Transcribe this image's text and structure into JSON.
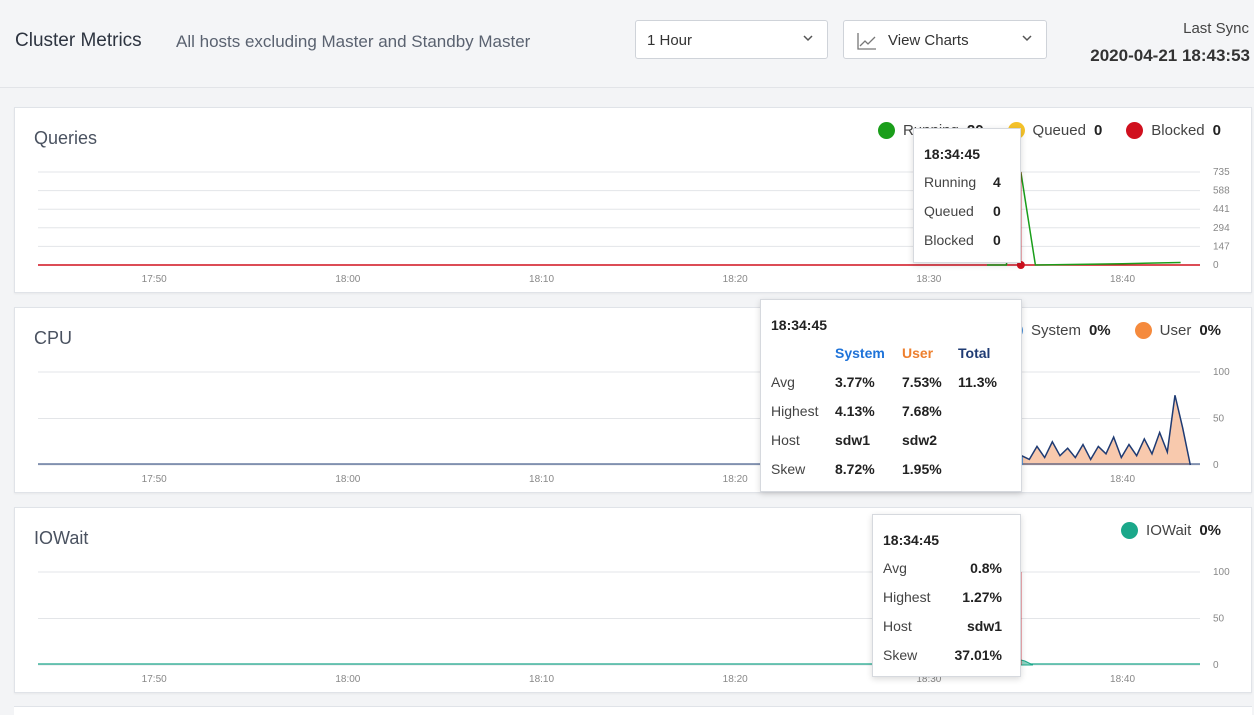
{
  "header": {
    "title": "Cluster Metrics",
    "subtitle": "All hosts excluding Master and Standby Master",
    "time_range": "1 Hour",
    "view_mode": "View Charts",
    "last_sync_label": "Last Sync",
    "last_sync_value": "2020-04-21 18:43:53",
    "icons": {
      "chevron": "chevron-down-icon",
      "view": "line-chart-icon"
    }
  },
  "x_ticks": [
    "17:50",
    "18:00",
    "18:10",
    "18:20",
    "18:30",
    "18:40"
  ],
  "queries": {
    "title": "Queries",
    "legend": [
      {
        "name": "Running",
        "value": "20",
        "color": "#1a9e1a"
      },
      {
        "name": "Queued",
        "value": "0",
        "color": "#f4c22b"
      },
      {
        "name": "Blocked",
        "value": "0",
        "color": "#d0101e"
      }
    ],
    "y_ticks": [
      "735",
      "588",
      "441",
      "294",
      "147",
      "0"
    ],
    "tooltip": {
      "time": "18:34:45",
      "rows": [
        {
          "label": "Running",
          "value": "4"
        },
        {
          "label": "Queued",
          "value": "0"
        },
        {
          "label": "Blocked",
          "value": "0"
        }
      ]
    }
  },
  "cpu": {
    "title": "CPU",
    "legend": [
      {
        "name": "System",
        "value": "0%",
        "color": "#4a90d9"
      },
      {
        "name": "User",
        "value": "0%",
        "color": "#f58a3d"
      }
    ],
    "y_ticks": [
      "100",
      "50",
      "0"
    ],
    "tooltip": {
      "time": "18:34:45",
      "columns": [
        "System",
        "User",
        "Total"
      ],
      "column_colors": [
        "#1e73d9",
        "#ee7f2d",
        "#1f3b73"
      ],
      "rows": [
        {
          "label": "Avg",
          "system": "3.77%",
          "user": "7.53%",
          "total": "11.3%"
        },
        {
          "label": "Highest",
          "system": "4.13%",
          "user": "7.68%",
          "total": ""
        },
        {
          "label": "Host",
          "system": "sdw1",
          "user": "sdw2",
          "total": ""
        },
        {
          "label": "Skew",
          "system": "8.72%",
          "user": "1.95%",
          "total": ""
        }
      ]
    }
  },
  "iowait": {
    "title": "IOWait",
    "legend": [
      {
        "name": "IOWait",
        "value": "0%",
        "color": "#1ba88a"
      }
    ],
    "y_ticks": [
      "100",
      "50",
      "0"
    ],
    "tooltip": {
      "time": "18:34:45",
      "rows": [
        {
          "label": "Avg",
          "value": "0.8%"
        },
        {
          "label": "Highest",
          "value": "1.27%"
        },
        {
          "label": "Host",
          "value": "sdw1"
        },
        {
          "label": "Skew",
          "value": "37.01%"
        }
      ]
    }
  },
  "chart_data": [
    {
      "type": "line",
      "name": "Queries",
      "x_ticks": [
        "17:50",
        "18:00",
        "18:10",
        "18:20",
        "18:30",
        "18:40"
      ],
      "ylim": [
        0,
        735
      ],
      "series": [
        {
          "name": "Running",
          "x": [
            "18:33:00",
            "18:34:00",
            "18:34:45",
            "18:35:30",
            "18:40:00",
            "18:43:00"
          ],
          "values": [
            0,
            0,
            735,
            0,
            10,
            20
          ]
        },
        {
          "name": "Queued",
          "x": [
            "17:44",
            "18:43"
          ],
          "values": [
            0,
            0
          ]
        },
        {
          "name": "Blocked",
          "x": [
            "17:44",
            "18:43"
          ],
          "values": [
            0,
            0
          ]
        }
      ]
    },
    {
      "type": "area",
      "name": "CPU",
      "x_ticks": [
        "17:50",
        "18:00",
        "18:10",
        "18:20",
        "18:30",
        "18:40"
      ],
      "ylim": [
        0,
        100
      ],
      "series": [
        {
          "name": "System",
          "values": [
            0,
            0,
            0,
            0,
            5,
            4,
            3,
            2
          ]
        },
        {
          "name": "User",
          "values": [
            0,
            0,
            0,
            0,
            8,
            40,
            30,
            75
          ]
        }
      ]
    },
    {
      "type": "area",
      "name": "IOWait",
      "x_ticks": [
        "17:50",
        "18:00",
        "18:10",
        "18:20",
        "18:30",
        "18:40"
      ],
      "ylim": [
        0,
        100
      ],
      "series": [
        {
          "name": "IOWait",
          "values": [
            0,
            0,
            0,
            0,
            2,
            1,
            0,
            0
          ]
        }
      ]
    }
  ]
}
